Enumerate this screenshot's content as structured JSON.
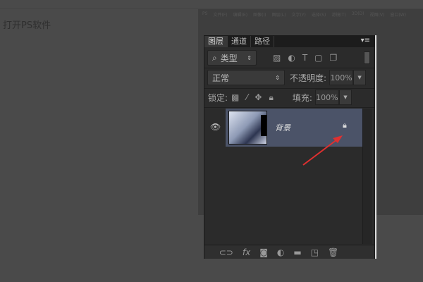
{
  "caption": "打开PS软件",
  "bg_menu": [
    "PS",
    "文件(F)",
    "编辑(E)",
    "图像(I)",
    "图层(L)",
    "文字(Y)",
    "选择(S)",
    "滤镜(T)",
    "3D(D)",
    "视图(V)",
    "窗口(W)"
  ],
  "tabs": [
    "图层",
    "通道",
    "路径"
  ],
  "filter": {
    "label": "类型"
  },
  "blend": {
    "mode": "正常",
    "opacity_label": "不透明度:",
    "opacity": "100%"
  },
  "lock": {
    "label": "锁定:",
    "fill_label": "填充:",
    "fill": "100%"
  },
  "layer": {
    "name": "背景"
  }
}
